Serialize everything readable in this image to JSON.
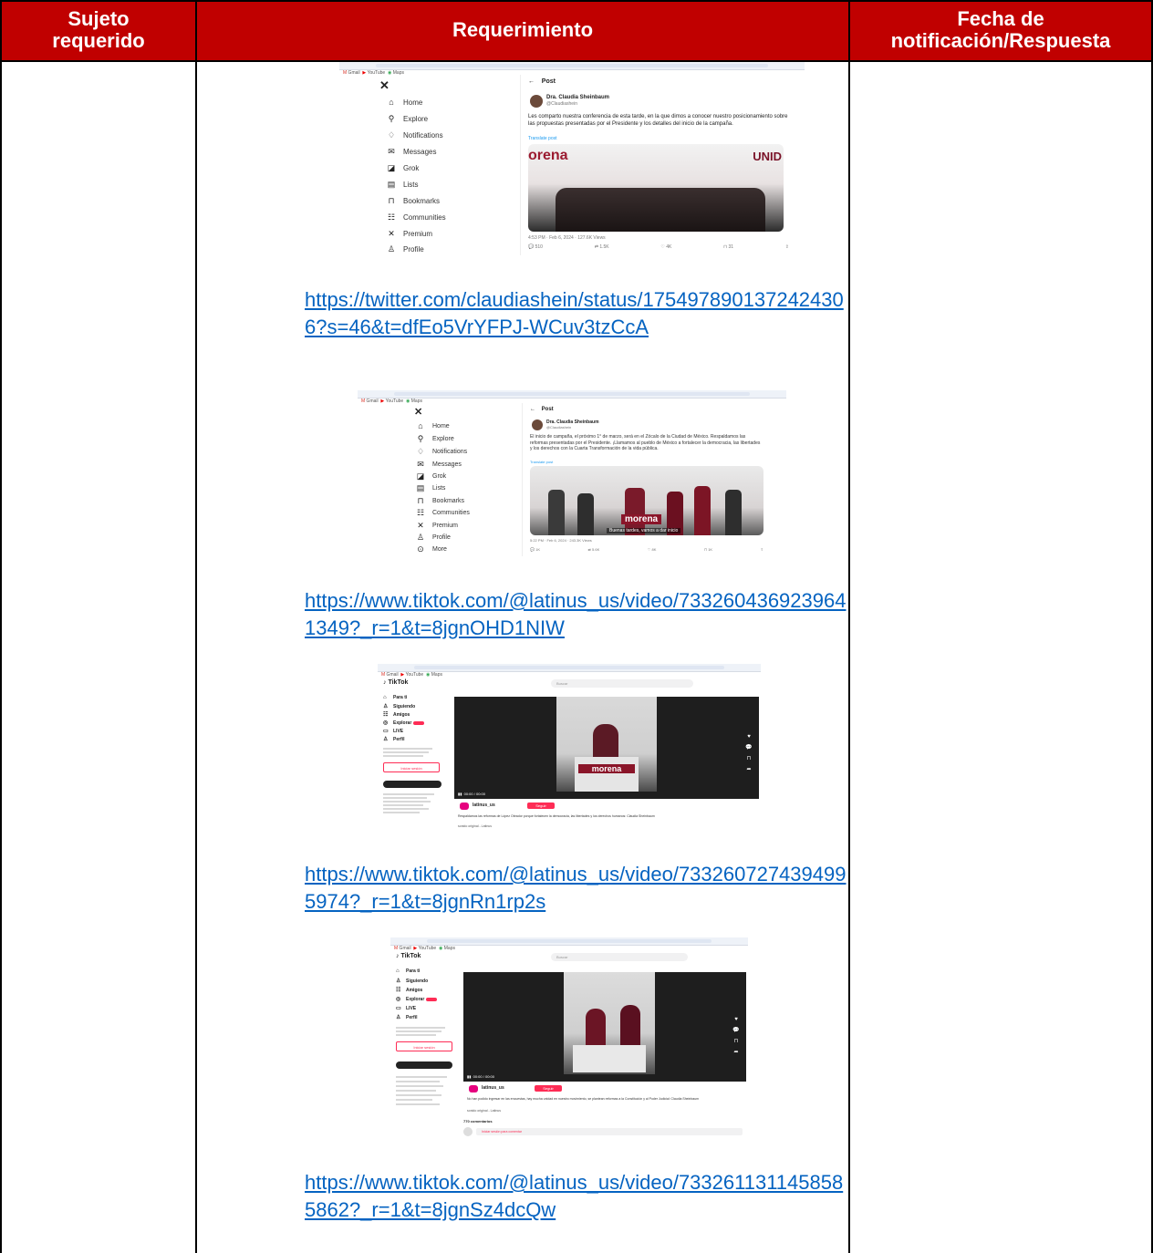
{
  "header": {
    "col1": "Sujeto requerido",
    "col2": "Requerimiento",
    "col3": "Fecha de notificación/Respuesta"
  },
  "links": [
    "https://twitter.com/claudiashein/status/1754978901372424306?s=46&t=dfEo5VrYFPJ-WCuv3tzCcA",
    "https://www.tiktok.com/@latinus_us/video/7332604369239641349?_r=1&t=8jgnOHD1NIW",
    "https://www.tiktok.com/@latinus_us/video/7332607274394995974?_r=1&t=8jgnRn1rp2s",
    "https://www.tiktok.com/@latinus_us/video/7332611311458585862?_r=1&t=8jgnSz4dcQw"
  ],
  "shot1": {
    "post_label": "Post",
    "author": "Dra. Claudia Sheinbaum",
    "handle": "@Claudiashein",
    "text": "Les comparto nuestra conferencia de esta tarde, en la que dimos a conocer nuestro posicionamiento sobre las propuestas presentadas por el Presidente y los detalles del inicio de la campaña.",
    "translate": "Translate post",
    "time": "4:53 PM · Feb 6, 2024 · 127.6K Views",
    "banner_left": "orena",
    "banner_right": "UNID",
    "stats": [
      "510",
      "1.5K",
      "4K",
      "31"
    ],
    "nav": [
      "Home",
      "Explore",
      "Notifications",
      "Messages",
      "Grok",
      "Lists",
      "Bookmarks",
      "Communities",
      "Premium",
      "Profile"
    ]
  },
  "shot2": {
    "post_label": "Post",
    "author": "Dra. Claudia Sheinbaum",
    "handle": "@Claudiashein",
    "text": "El inicio de campaña, el próximo 1° de marzo, será en el Zócalo de la Ciudad de México. Respaldamos las reformas presentadas por el Presidente. ¡Llamamos al pueblo de México a fortalecer la democracia, las libertades y los derechos con la Cuarta Transformación de la vida pública.",
    "translate": "Translate post",
    "time": "5:22 PM · Feb 6, 2024 · 243.3K Views",
    "caption": "Buenas tardes, vamos a dar inicio",
    "banner": "morena",
    "stats": [
      "1K",
      "5.6K",
      "8K",
      "1K"
    ],
    "nav": [
      "Home",
      "Explore",
      "Notifications",
      "Messages",
      "Grok",
      "Lists",
      "Bookmarks",
      "Communities",
      "Premium",
      "Profile",
      "More"
    ]
  },
  "shot3": {
    "logo": "TikTok",
    "search": "Buscar",
    "nav": [
      "Para ti",
      "Siguiendo",
      "Amigos",
      "Explorar",
      "LIVE",
      "Perfil"
    ],
    "login": "Iniciar sesión",
    "banner": "morena",
    "account": "latinus_us",
    "follow": "Seguir",
    "desc": "Respaldamos las reformas de López Obrador porque fortalecen la democracia, las libertades y los derechos humanos: Claudia Sheinbaum",
    "sound": "sonido original - Latinus"
  },
  "shot4": {
    "logo": "TikTok",
    "search": "Buscar",
    "nav": [
      "Para ti",
      "Siguiendo",
      "Amigos",
      "Explorar",
      "LIVE",
      "Perfil"
    ],
    "login": "Iniciar sesión",
    "account": "latinus_us",
    "follow": "Seguir",
    "desc": "No han podido ingresar en las encuestas, hay mucha unidad en nuestro movimiento, se plantean reformas a la Constitución y al Poder Judicial: Claudia Sheinbaum",
    "sound": "sonido original - Latinus",
    "comments": "770 comentarios",
    "comment_box": "Iniciar sesión para comentar"
  }
}
